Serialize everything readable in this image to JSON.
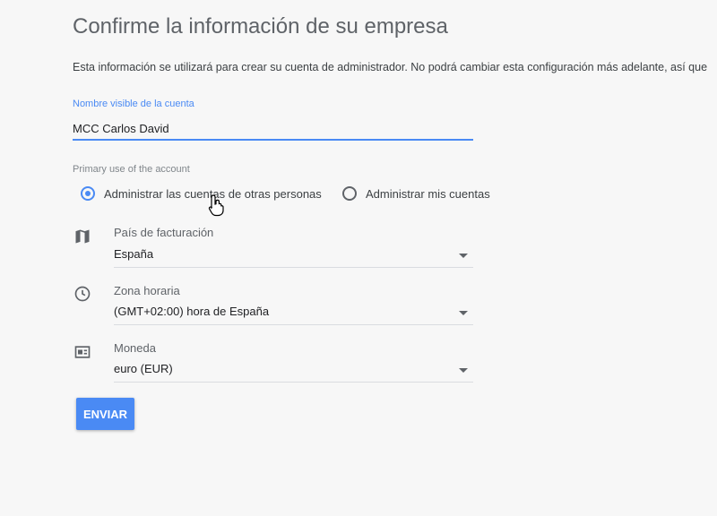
{
  "title": "Confirme la información de su empresa",
  "description": "Esta información se utilizará para crear su cuenta de administrador. No podrá cambiar esta configuración más adelante, así que",
  "account_name": {
    "label": "Nombre visible de la cuenta",
    "value": "MCC Carlos David"
  },
  "primary_use": {
    "label": "Primary use of the account",
    "options": [
      {
        "label": "Administrar las cuentas de otras personas",
        "selected": true
      },
      {
        "label": "Administrar mis cuentas",
        "selected": false
      }
    ]
  },
  "fields": {
    "country": {
      "label": "País de facturación",
      "value": "España",
      "icon": "map-icon"
    },
    "timezone": {
      "label": "Zona horaria",
      "value": "(GMT+02:00) hora de España",
      "icon": "clock-icon"
    },
    "currency": {
      "label": "Moneda",
      "value": "euro (EUR)",
      "icon": "currency-icon"
    }
  },
  "submit": {
    "label": "ENVIAR"
  },
  "colors": {
    "accent": "#4a8af4",
    "background": "#f7f7f7"
  }
}
